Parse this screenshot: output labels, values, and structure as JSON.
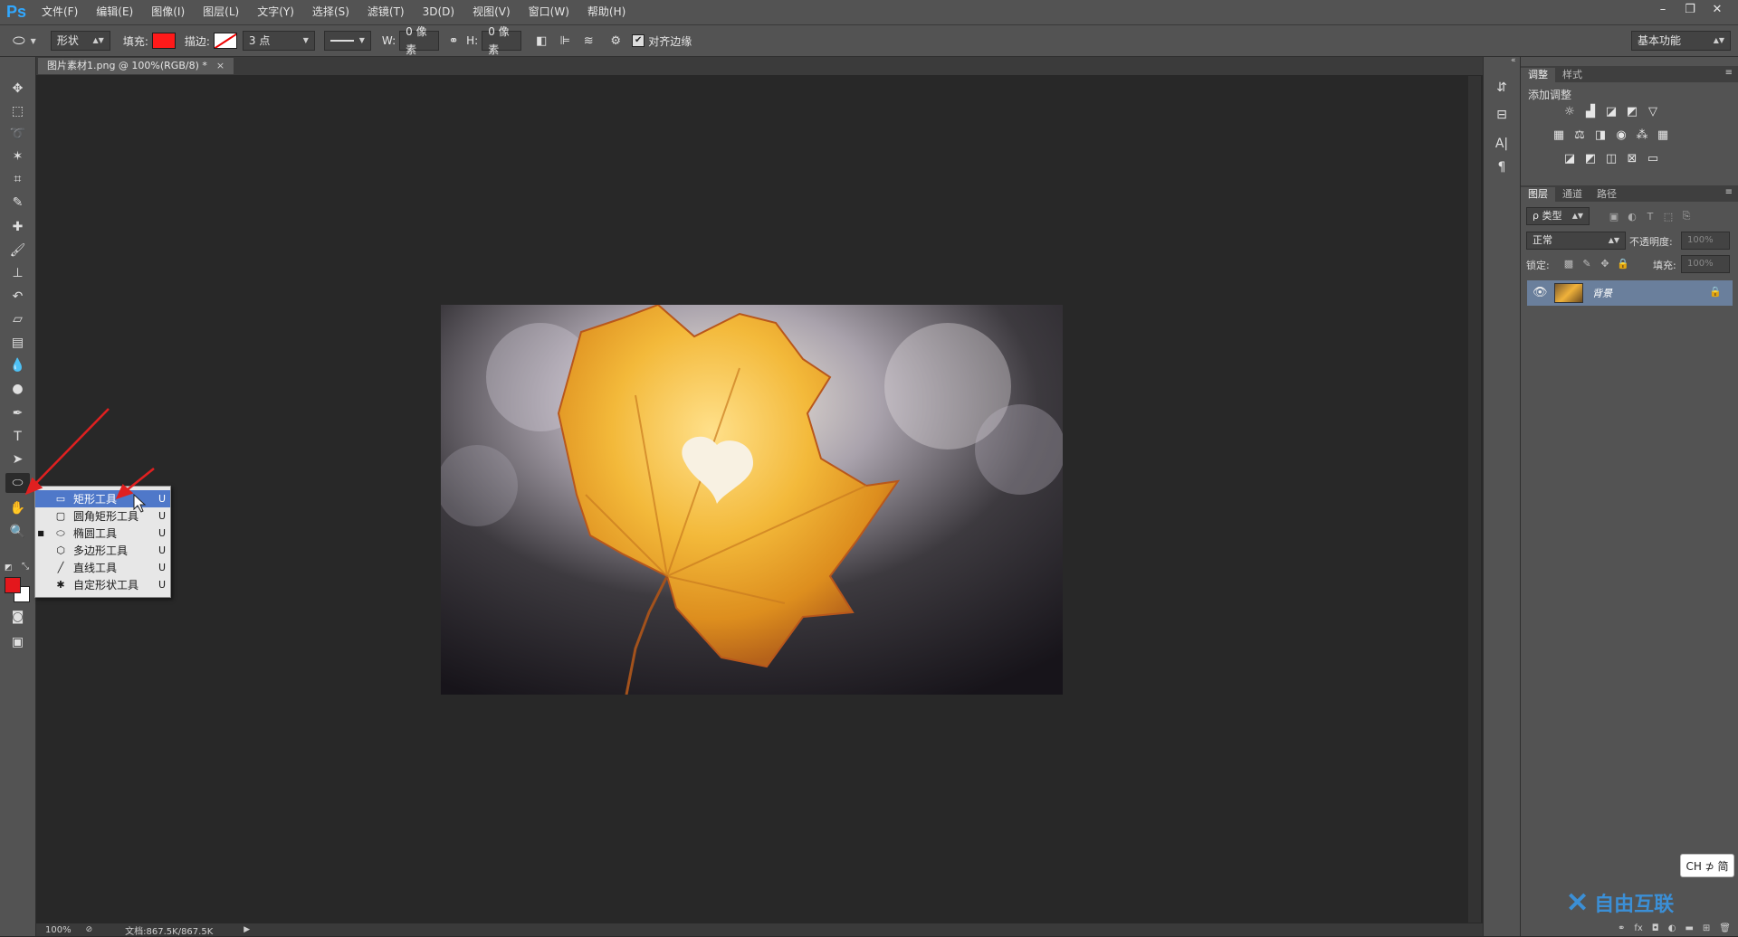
{
  "app": {
    "logo": "Ps",
    "menu": [
      "文件(F)",
      "编辑(E)",
      "图像(I)",
      "图层(L)",
      "文字(Y)",
      "选择(S)",
      "滤镜(T)",
      "3D(D)",
      "视图(V)",
      "窗口(W)",
      "帮助(H)"
    ],
    "window_controls": [
      "–",
      "❐",
      "✕"
    ]
  },
  "options_bar": {
    "mode_dropdown": "形状",
    "fill_label": "填充:",
    "fill_color": "#ff1a1a",
    "stroke_label": "描边:",
    "stroke_width": "3 点",
    "w_label": "W:",
    "w_value": "0 像素",
    "h_label": "H:",
    "h_value": "0 像素",
    "align_edges_label": "对齐边缘",
    "align_edges_checked": true,
    "workspace": "基本功能"
  },
  "document": {
    "tab_title": "图片素材1.png @ 100%(RGB/8) *",
    "zoom": "100%",
    "doc_info": "文档:867.5K/867.5K"
  },
  "toolbar": {
    "foreground_color": "#e4171c",
    "background_color": "#ffffff"
  },
  "shape_flyout": {
    "items": [
      {
        "label": "矩形工具",
        "shortcut": "U",
        "icon": "rectangle-icon",
        "highlighted": true,
        "current": false
      },
      {
        "label": "圆角矩形工具",
        "shortcut": "U",
        "icon": "rounded-rectangle-icon",
        "highlighted": false,
        "current": false
      },
      {
        "label": "椭圆工具",
        "shortcut": "U",
        "icon": "ellipse-icon",
        "highlighted": false,
        "current": true
      },
      {
        "label": "多边形工具",
        "shortcut": "U",
        "icon": "polygon-icon",
        "highlighted": false,
        "current": false
      },
      {
        "label": "直线工具",
        "shortcut": "U",
        "icon": "line-icon",
        "highlighted": false,
        "current": false
      },
      {
        "label": "自定形状工具",
        "shortcut": "U",
        "icon": "custom-shape-icon",
        "highlighted": false,
        "current": false
      }
    ]
  },
  "panels": {
    "adjust_tabs": [
      "调整",
      "样式"
    ],
    "add_adjustment": "添加调整",
    "layer_tabs": [
      "图层",
      "通道",
      "路径"
    ],
    "kind_filter": "ρ 类型",
    "blend_mode": "正常",
    "opacity_label": "不透明度:",
    "opacity_value": "100%",
    "lock_label": "锁定:",
    "fill_label": "填充:",
    "fill_value": "100%",
    "layer_name": "背景"
  },
  "ime": "CH ⊅ 简",
  "watermark": "自由互联"
}
